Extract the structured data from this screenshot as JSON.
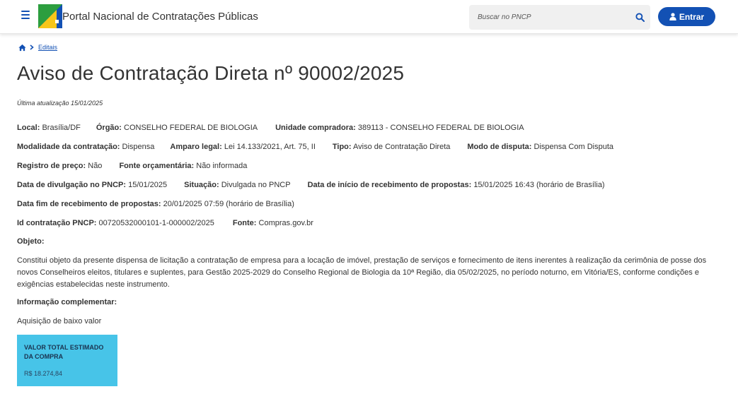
{
  "header": {
    "portal_title": "Portal Nacional de Contratações Públicas",
    "search_placeholder": "Buscar no PNCP",
    "login_label": "Entrar",
    "brand_color": "#1351b4"
  },
  "breadcrumb": {
    "items": [
      "Editais"
    ]
  },
  "page": {
    "title": "Aviso de Contratação Direta nº 90002/2025",
    "last_update": "Última atualização 15/01/2025"
  },
  "details": {
    "local_label": "Local:",
    "local_value": "Brasília/DF",
    "orgao_label": "Órgão:",
    "orgao_value": "CONSELHO FEDERAL DE BIOLOGIA",
    "unidade_label": "Unidade compradora:",
    "unidade_value": "389113 - CONSELHO FEDERAL DE BIOLOGIA",
    "modalidade_label": "Modalidade da contratação:",
    "modalidade_value": "Dispensa",
    "amparo_label": "Amparo legal:",
    "amparo_value": "Lei 14.133/2021, Art. 75, II",
    "tipo_label": "Tipo:",
    "tipo_value": "Aviso de Contratação Direta",
    "modo_label": "Modo de disputa:",
    "modo_value": "Dispensa Com Disputa",
    "registro_label": "Registro de preço:",
    "registro_value": "Não",
    "fonte_orc_label": "Fonte orçamentária:",
    "fonte_orc_value": "Não informada",
    "divulgacao_label": "Data de divulgação no PNCP:",
    "divulgacao_value": "15/01/2025",
    "situacao_label": "Situação:",
    "situacao_value": "Divulgada no PNCP",
    "inicio_label": "Data de início de recebimento de propostas:",
    "inicio_value": "15/01/2025 16:43 (horário de Brasília)",
    "fim_label": "Data fim de recebimento de propostas:",
    "fim_value": "20/01/2025 07:59 (horário de Brasília)",
    "id_label": "Id contratação PNCP:",
    "id_value": "00720532000101-1-000002/2025",
    "fonte_label": "Fonte:",
    "fonte_value": "Compras.gov.br"
  },
  "objeto": {
    "label": "Objeto:",
    "text": "Constitui objeto da presente dispensa de licitação a contratação de empresa para a locação de imóvel, prestação de serviços e fornecimento de itens inerentes à realização da cerimônia de posse dos novos Conselheiros eleitos, titulares e suplentes, para Gestão 2025-2029 do Conselho Regional de Biologia da 10ª Região, dia 05/02/2025, no período noturno, em Vitória/ES, conforme condições e exigências estabelecidas neste instrumento."
  },
  "complementar": {
    "label": "Informação complementar:",
    "text": "Aquisição de baixo valor"
  },
  "valor": {
    "title": "VALOR TOTAL ESTIMADO DA COMPRA",
    "value": "R$ 18.274,84",
    "card_color": "#47c4e8"
  }
}
